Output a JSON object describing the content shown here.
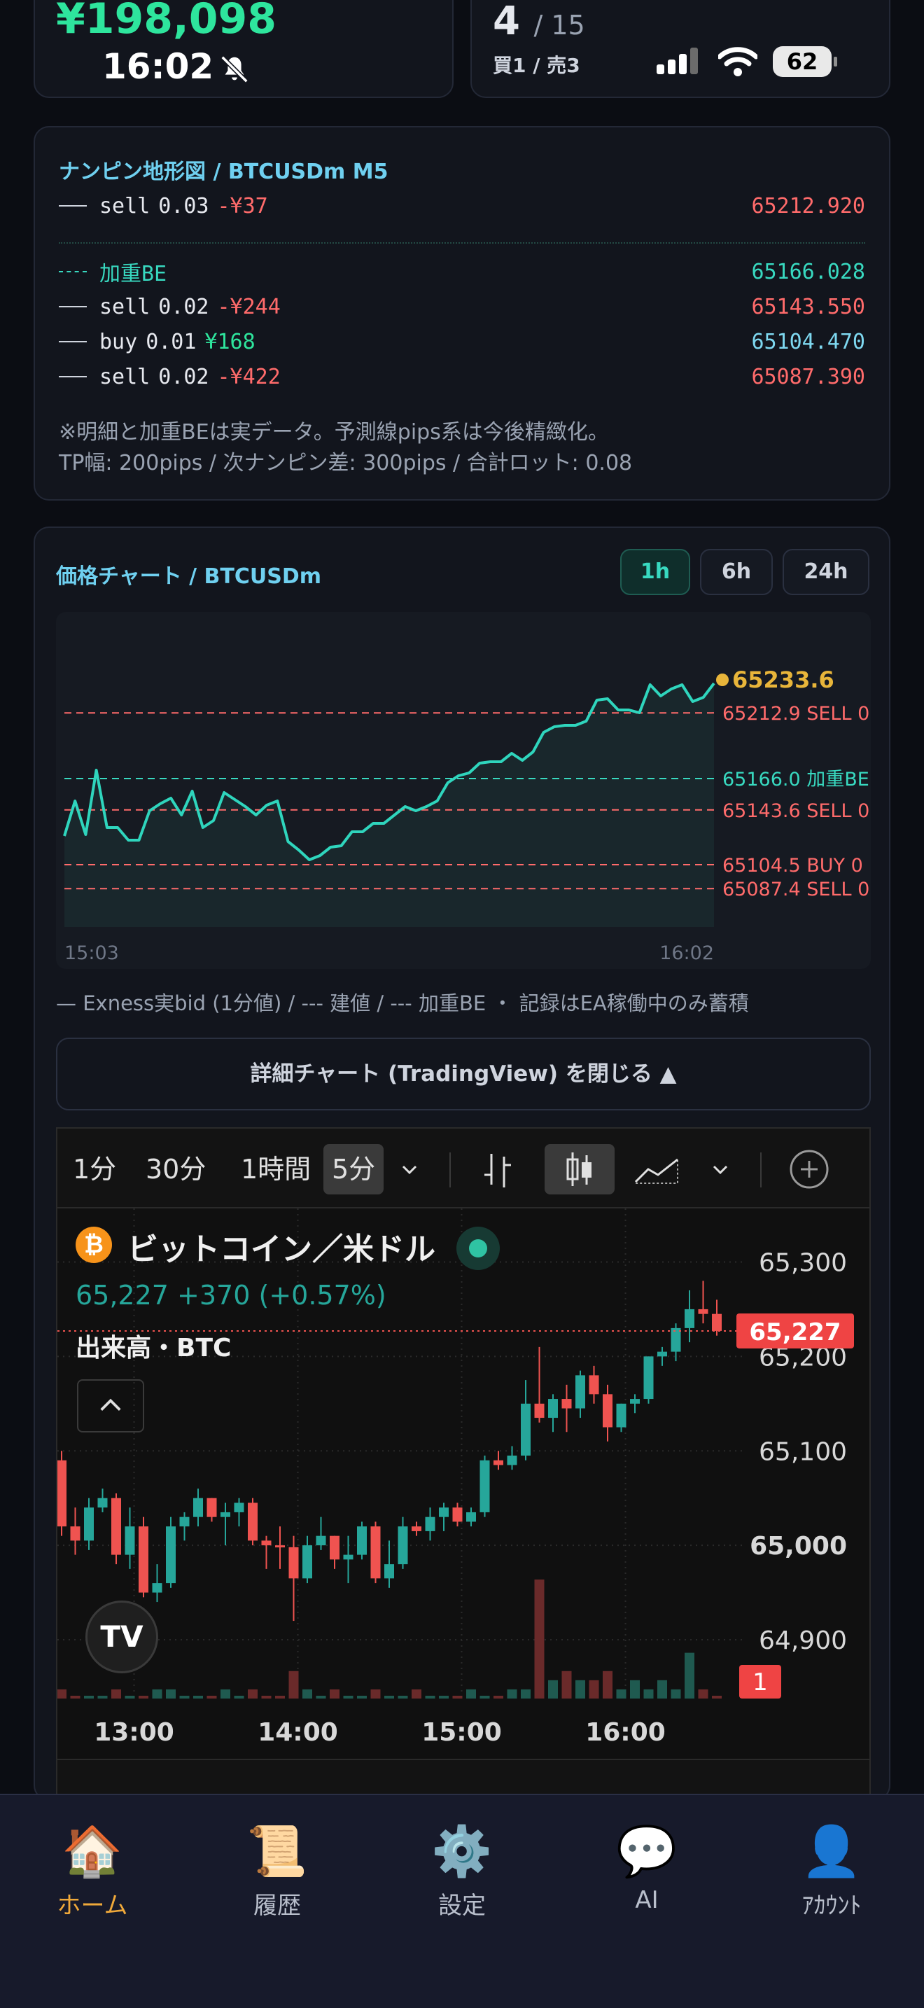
{
  "top_left": {
    "balance": "¥198,098",
    "time": "16:02"
  },
  "top_right": {
    "positions": "4",
    "positions_total": "/ 15",
    "buy_sell": "買1 / 売3",
    "battery": "62"
  },
  "nanpin": {
    "title": "ナンピン地形図 / BTCUSDm M5",
    "rows": [
      {
        "side": "sell",
        "lot": "0.03",
        "pl": "-¥37",
        "price": "65212.920"
      },
      {
        "label": "加重BE",
        "price": "65166.028"
      },
      {
        "side": "sell",
        "lot": "0.02",
        "pl": "-¥244",
        "price": "65143.550"
      },
      {
        "side": "buy",
        "lot": "0.01",
        "pl": "¥168",
        "price": "65104.470"
      },
      {
        "side": "sell",
        "lot": "0.02",
        "pl": "-¥422",
        "price": "65087.390"
      }
    ],
    "note1": "※明細と加重BEは実データ。予測線pips系は今後精緻化。",
    "note2": "TP幅: 200pips / 次ナンピン差: 300pips / 合計ロット: 0.08"
  },
  "price_chart": {
    "title": "価格チャート / BTCUSDm",
    "timeframes": [
      "1h",
      "6h",
      "24h"
    ],
    "active_timeframe": "1h",
    "legend": "— Exness実bid (1分値) / --- 建値 / --- 加重BE ・ 記録はEA稼働中のみ蓄積",
    "close_button": "詳細チャート (TradingView) を閉じる ▲"
  },
  "chart_data": {
    "type": "line",
    "x_start": "15:03",
    "x_end": "16:02",
    "current_value": "65233.6",
    "ylim": [
      65060,
      65270
    ],
    "y": [
      65125,
      65150,
      65126,
      65172,
      65131,
      65131,
      65122,
      65122,
      65143,
      65148,
      65152,
      65140,
      65157,
      65131,
      65136,
      65156,
      65151,
      65146,
      65140,
      65147,
      65150,
      65121,
      65115,
      65108,
      65111,
      65117,
      65118,
      65128,
      65128,
      65134,
      65134,
      65140,
      65146,
      65143,
      65146,
      65150,
      65163,
      65168,
      65170,
      65177,
      65178,
      65178,
      65184,
      65179,
      65185,
      65199,
      65203,
      65204,
      65204,
      65207,
      65222,
      65223,
      65215,
      65215,
      65213,
      65233,
      65225,
      65230,
      65233,
      65221,
      65224,
      65234
    ],
    "levels": [
      {
        "value": 65212.9,
        "label": "65212.9 SELL 0",
        "color": "#ff6b6b"
      },
      {
        "value": 65166.0,
        "label": "65166.0 加重BE",
        "color": "#38d9c0"
      },
      {
        "value": 65143.6,
        "label": "65143.6 SELL 0",
        "color": "#ff6b6b"
      },
      {
        "value": 65104.5,
        "label": "65104.5 BUY 0",
        "color": "#ff6b6b"
      },
      {
        "value": 65087.4,
        "label": "65087.4 SELL 0",
        "color": "#ff6b6b"
      }
    ],
    "line_color": "#2fd5bd"
  },
  "tradingview": {
    "timeframes": [
      "1分",
      "30分",
      "1時間",
      "5分"
    ],
    "active_timeframe": "5分",
    "symbol": "ビットコイン／米ドル",
    "price_line": "65,227 +370 (+0.57%)",
    "volume_label": "出来高・BTC",
    "price_tag": "65,227",
    "badge": "1",
    "y_ticks": [
      "65,300",
      "65,200",
      "65,100",
      "65,000",
      "64,900"
    ],
    "x_ticks": [
      "13:00",
      "14:00",
      "15:00",
      "16:00"
    ],
    "logo": "TV",
    "candles": {
      "ylim": [
        64860,
        65330
      ],
      "ohlc": [
        [
          65090,
          65100,
          65010,
          65020
        ],
        [
          65020,
          65040,
          64990,
          65005
        ],
        [
          65005,
          65050,
          64995,
          65040
        ],
        [
          65040,
          65060,
          65035,
          65050
        ],
        [
          65050,
          65055,
          64980,
          64990
        ],
        [
          64990,
          65040,
          64975,
          65020
        ],
        [
          65020,
          65030,
          64945,
          64950
        ],
        [
          64950,
          64980,
          64940,
          64960
        ],
        [
          64960,
          65030,
          64955,
          65020
        ],
        [
          65020,
          65035,
          65005,
          65030
        ],
        [
          65030,
          65060,
          65020,
          65050
        ],
        [
          65050,
          65050,
          65025,
          65030
        ],
        [
          65030,
          65045,
          65000,
          65035
        ],
        [
          65035,
          65050,
          65020,
          65045
        ],
        [
          65045,
          65050,
          65000,
          65005
        ],
        [
          65005,
          65010,
          64975,
          65000
        ],
        [
          65000,
          65020,
          64975,
          64998
        ],
        [
          64998,
          65010,
          64920,
          64965
        ],
        [
          64965,
          65010,
          64960,
          65000
        ],
        [
          65000,
          65030,
          64995,
          65010
        ],
        [
          65010,
          65010,
          64975,
          64985
        ],
        [
          64985,
          65010,
          64960,
          64990
        ],
        [
          64990,
          65025,
          64985,
          65020
        ],
        [
          65020,
          65025,
          64960,
          64965
        ],
        [
          64965,
          65005,
          64955,
          64980
        ],
        [
          64980,
          65030,
          64975,
          65020
        ],
        [
          65020,
          65025,
          65010,
          65015
        ],
        [
          65015,
          65040,
          65005,
          65030
        ],
        [
          65030,
          65045,
          65015,
          65040
        ],
        [
          65040,
          65045,
          65020,
          65025
        ],
        [
          65025,
          65040,
          65020,
          65035
        ],
        [
          65035,
          65095,
          65030,
          65090
        ],
        [
          65090,
          65100,
          65080,
          65085
        ],
        [
          65085,
          65105,
          65080,
          65095
        ],
        [
          65095,
          65175,
          65090,
          65150
        ],
        [
          65150,
          65210,
          65130,
          65135
        ],
        [
          65135,
          65160,
          65120,
          65155
        ],
        [
          65155,
          65170,
          65120,
          65145
        ],
        [
          65145,
          65185,
          65135,
          65180
        ],
        [
          65180,
          65190,
          65150,
          65160
        ],
        [
          65160,
          65170,
          65110,
          65125
        ],
        [
          65125,
          65150,
          65120,
          65150
        ],
        [
          65150,
          65160,
          65140,
          65155
        ],
        [
          65155,
          65200,
          65150,
          65200
        ],
        [
          65200,
          65210,
          65190,
          65205
        ],
        [
          65205,
          65235,
          65195,
          65230
        ],
        [
          65230,
          65270,
          65215,
          65250
        ],
        [
          65250,
          65280,
          65235,
          65245
        ],
        [
          65245,
          65260,
          65222,
          65227
        ]
      ],
      "volume": [
        1,
        0,
        0,
        0,
        1,
        0,
        0,
        1,
        1,
        0,
        0,
        0,
        1,
        0,
        1,
        0,
        0,
        3,
        1,
        0,
        1,
        0,
        0,
        1,
        0,
        0,
        1,
        0,
        0,
        0,
        1,
        0,
        0,
        1,
        1,
        13,
        2,
        3,
        2,
        2,
        3,
        1,
        2,
        1,
        2,
        1,
        5,
        1,
        0
      ]
    }
  },
  "nav": [
    {
      "icon": "🏠",
      "label": "ホーム",
      "active": true
    },
    {
      "icon": "📜",
      "label": "履歴",
      "active": false
    },
    {
      "icon": "⚙️",
      "label": "設定",
      "active": false
    },
    {
      "icon": "💬",
      "label": "AI",
      "active": false
    },
    {
      "icon": "👤",
      "label": "ｱｶｳﾝﾄ",
      "active": false
    }
  ]
}
